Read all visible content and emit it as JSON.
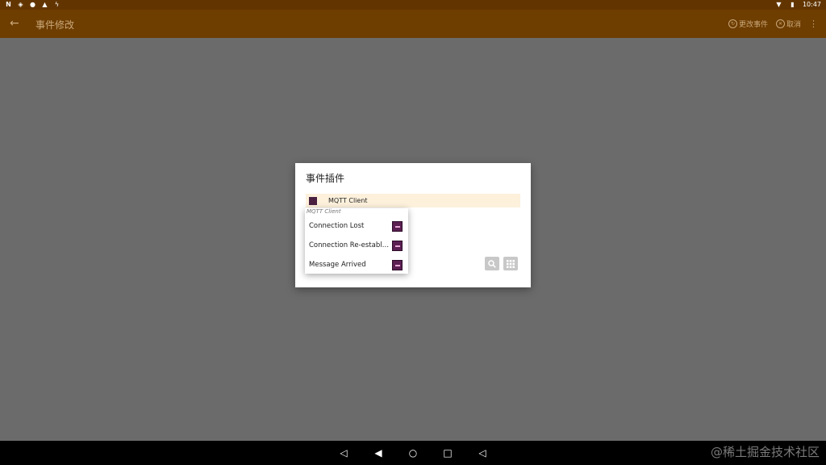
{
  "status_bar": {
    "time": "10:47",
    "left_icons": [
      "n-notification-icon",
      "vpn-icon",
      "circle-icon",
      "bell-icon",
      "flash-icon"
    ],
    "right_icons": [
      "wifi-icon",
      "battery-icon"
    ]
  },
  "app_bar": {
    "title": "事件修改",
    "actions": [
      {
        "label": "更改事件",
        "icon": "refresh-icon"
      },
      {
        "label": "取消",
        "icon": "cancel-icon"
      }
    ]
  },
  "dialog": {
    "title": "事件插件",
    "selected_plugin": "MQTT Client"
  },
  "dropdown": {
    "header": "MQTT Client",
    "items": [
      {
        "label": "Connection Lost"
      },
      {
        "label": "Connection Re-established"
      },
      {
        "label": "Message Arrived"
      }
    ]
  },
  "watermark": "@稀土掘金技术社区",
  "colors": {
    "status_bar": "#623500",
    "app_bar": "#6e3d00",
    "scrim": "#6b6b6b",
    "selected_row": "#fdf1dc",
    "plugin_icon": "#5b1f52"
  }
}
